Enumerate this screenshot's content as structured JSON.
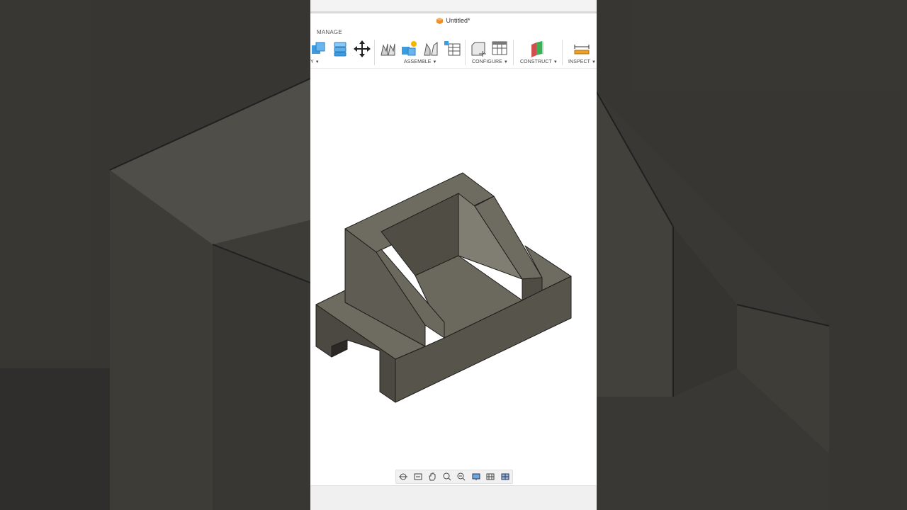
{
  "document": {
    "title": "Untitled*"
  },
  "toolbar": {
    "manage_label": "MANAGE",
    "groups": [
      {
        "label": "Y"
      },
      {
        "label": "ASSEMBLE"
      },
      {
        "label": "CONFIGURE"
      },
      {
        "label": "CONSTRUCT"
      },
      {
        "label": "INSPECT"
      }
    ]
  },
  "colors": {
    "accent_orange": "#f08a24",
    "icon_blue": "#3d9be0",
    "model_top": "#6e6b60",
    "model_side": "#5d5a51",
    "model_front": "#4f4c44"
  }
}
